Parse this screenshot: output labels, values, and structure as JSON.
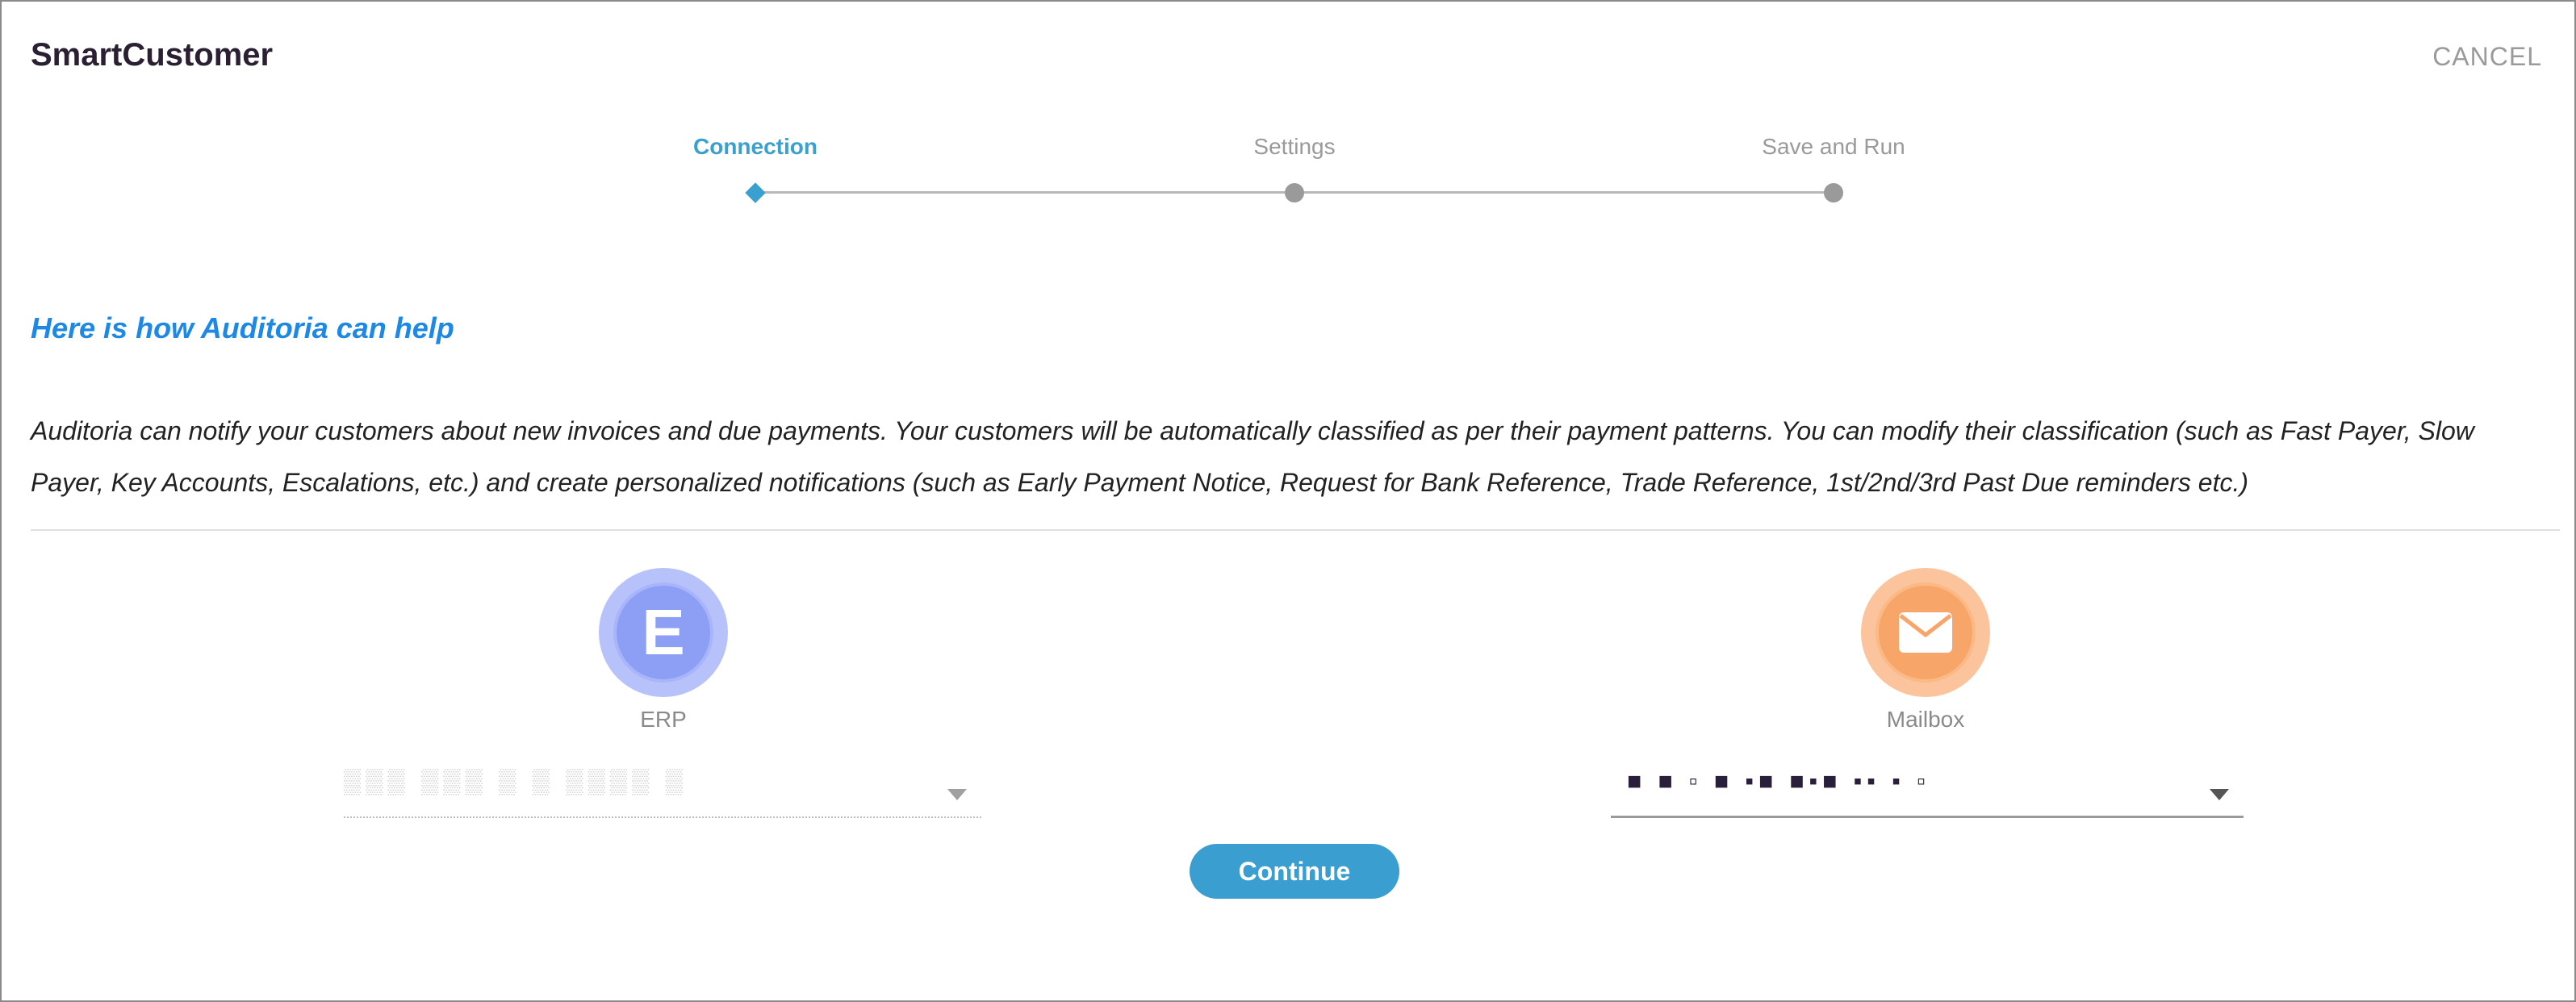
{
  "app": {
    "title": "SmartCustomer",
    "cancel_label": "CANCEL"
  },
  "stepper": {
    "steps": [
      {
        "label": "Connection",
        "active": true
      },
      {
        "label": "Settings",
        "active": false
      },
      {
        "label": "Save and Run",
        "active": false
      }
    ]
  },
  "help": {
    "title": "Here is how Auditoria can help",
    "text": "Auditoria can notify your customers about new invoices and due payments. Your customers will be automatically classified as per their payment patterns. You can modify their classification (such as Fast Payer, Slow Payer, Key Accounts, Escalations, etc.) and create personalized notifications (such as Early Payment Notice, Request for Bank Reference, Trade Reference, 1st/2nd/3rd Past Due reminders etc.)"
  },
  "connectors": {
    "erp": {
      "label": "ERP",
      "icon_letter": "E",
      "icon": "erp-icon",
      "value": "▒▒▒  ▒▒▒ ▒ ▒ ▒▒▒▒ ▒"
    },
    "mailbox": {
      "label": "Mailbox",
      "icon": "envelope-icon",
      "value": "■ ■  ▫    ■ ▪■ ■▪■  ▪▪  ▪ ▫"
    }
  },
  "actions": {
    "continue_label": "Continue"
  },
  "colors": {
    "accent": "#3a9fd0",
    "help_title": "#1e88e5",
    "erp_icon": "#8d9ef5",
    "mail_icon": "#f8a56a"
  }
}
